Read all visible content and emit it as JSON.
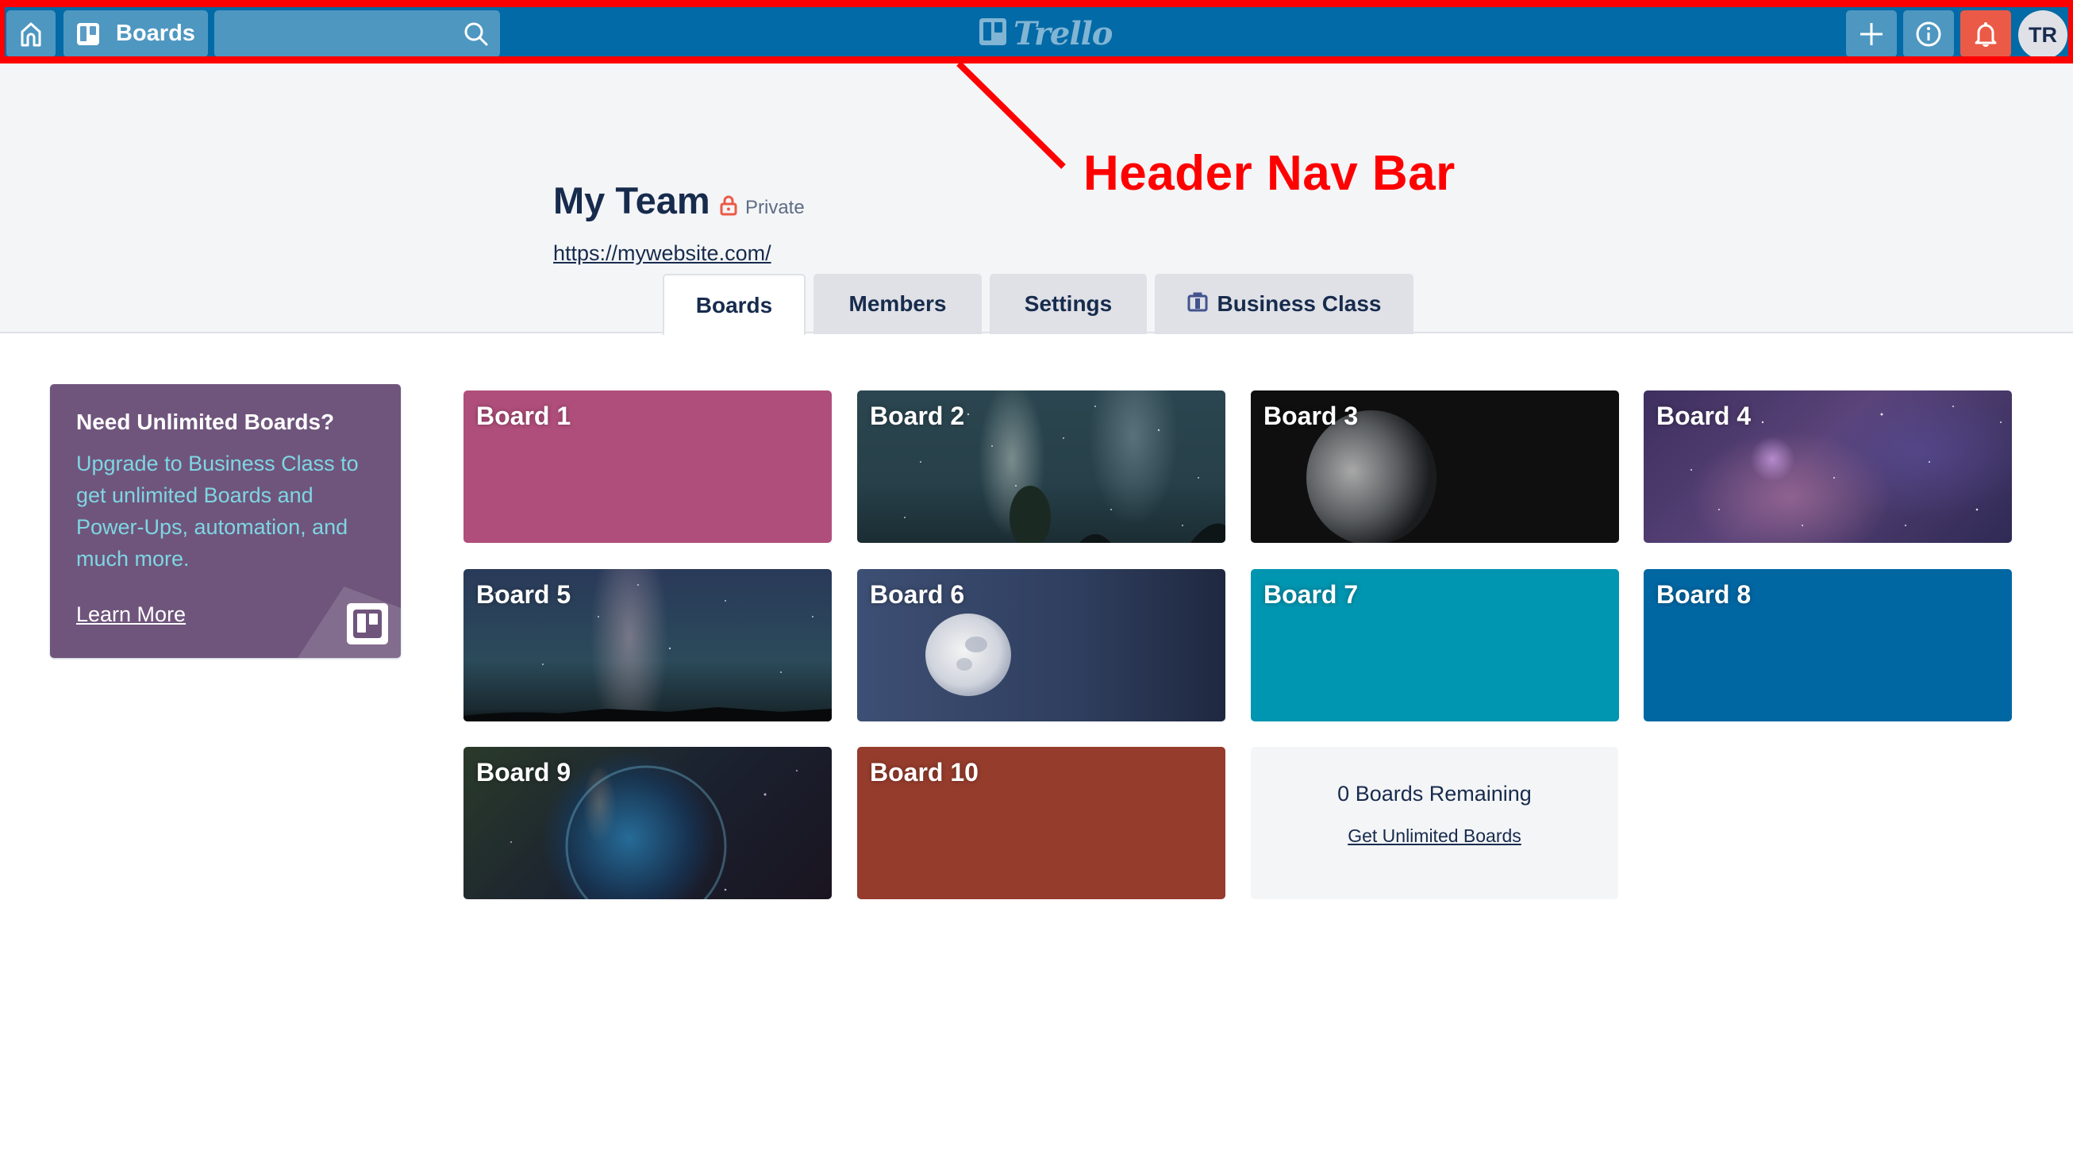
{
  "header": {
    "home_icon": "home-icon",
    "boards_label": "Boards",
    "search_value": "",
    "search_placeholder": "",
    "logo_text": "Trello",
    "create_icon": "plus-icon",
    "info_icon": "info-icon",
    "notifications_icon": "bell-icon",
    "avatar_initials": "TR",
    "colors": {
      "bar": "#026aa7",
      "notifications": "#eb5a46"
    }
  },
  "annotation": {
    "label": "Header Nav Bar",
    "color": "#ff0000"
  },
  "team": {
    "name": "My Team",
    "visibility": "Private",
    "visibility_icon": "lock-icon",
    "website": "https://mywebsite.com/"
  },
  "tabs": [
    {
      "label": "Boards",
      "active": true
    },
    {
      "label": "Members",
      "active": false
    },
    {
      "label": "Settings",
      "active": false
    },
    {
      "label": "Business Class",
      "active": false,
      "icon": "briefcase-icon"
    }
  ],
  "promo": {
    "title": "Need Unlimited Boards?",
    "body": "Upgrade to Business Class to get unlimited Boards and Power-Ups, automation, and much more.",
    "link": "Learn More",
    "background": "#6f557c"
  },
  "boards": [
    {
      "title": "Board 1",
      "background": "#b04e7b"
    },
    {
      "title": "Board 2",
      "background": "photo: milky way over tree"
    },
    {
      "title": "Board 3",
      "background": "photo: moon on black"
    },
    {
      "title": "Board 4",
      "background": "photo: purple nebula"
    },
    {
      "title": "Board 5",
      "background": "photo: milky way over treeline"
    },
    {
      "title": "Board 6",
      "background": "photo: moon in blue sky"
    },
    {
      "title": "Board 7",
      "background": "#0095b0"
    },
    {
      "title": "Board 8",
      "background": "#0067a3"
    },
    {
      "title": "Board 9",
      "background": "photo: bubble nebula"
    },
    {
      "title": "Board 10",
      "background": "#963c2d"
    }
  ],
  "remaining": {
    "count_text": "0 Boards Remaining",
    "link": "Get Unlimited Boards"
  }
}
